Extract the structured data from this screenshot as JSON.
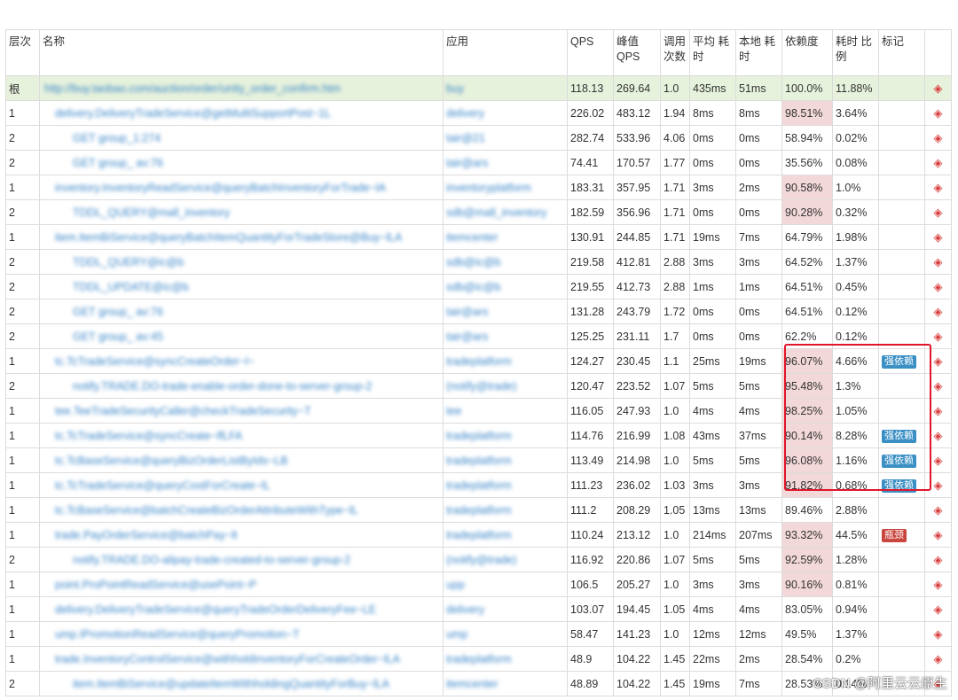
{
  "headers": {
    "level": "层次",
    "name": "名称",
    "app": "应用",
    "qps": "QPS",
    "peak_qps": "峰值 QPS",
    "call_count": "调用 次数",
    "avg_time": "平均 耗时",
    "local_time": "本地 耗时",
    "dependency": "依赖度",
    "time_ratio": "耗时 比例",
    "mark": "标记"
  },
  "rows": [
    {
      "level": "根",
      "name": "http://buy.taobao.com/auction/order/unity_order_confirm.htm",
      "app": "buy",
      "qps": "118.13",
      "peak": "269.64",
      "calls": "1.0",
      "avg": "435ms",
      "local": "51ms",
      "dep": "100.0%",
      "ratio": "11.88%",
      "mark": "",
      "markType": "",
      "hl": false
    },
    {
      "level": "1",
      "name": "delivery.DeliveryTradeService@getMultiSupportPost~1L",
      "app": "delivery",
      "qps": "226.02",
      "peak": "483.12",
      "calls": "1.94",
      "avg": "8ms",
      "local": "8ms",
      "dep": "98.51%",
      "ratio": "3.64%",
      "mark": "",
      "markType": "",
      "hl": true
    },
    {
      "level": "2",
      "name": "GET group_1:274",
      "app": "tair@21",
      "qps": "282.74",
      "peak": "533.96",
      "calls": "4.06",
      "avg": "0ms",
      "local": "0ms",
      "dep": "58.94%",
      "ratio": "0.02%",
      "mark": "",
      "markType": "",
      "hl": false
    },
    {
      "level": "2",
      "name": "GET group_ av:76",
      "app": "tair@ars",
      "qps": "74.41",
      "peak": "170.57",
      "calls": "1.77",
      "avg": "0ms",
      "local": "0ms",
      "dep": "35.56%",
      "ratio": "0.08%",
      "mark": "",
      "markType": "",
      "hl": false
    },
    {
      "level": "1",
      "name": "inventory.InventoryReadService@queryBatchInventoryForTrade~lA",
      "app": "inventoryplatform",
      "qps": "183.31",
      "peak": "357.95",
      "calls": "1.71",
      "avg": "3ms",
      "local": "2ms",
      "dep": "90.58%",
      "ratio": "1.0%",
      "mark": "",
      "markType": "",
      "hl": true
    },
    {
      "level": "2",
      "name": "TDDL_QUERY@mall_inventory",
      "app": "sdb@mall_inventory",
      "qps": "182.59",
      "peak": "356.96",
      "calls": "1.71",
      "avg": "0ms",
      "local": "0ms",
      "dep": "90.28%",
      "ratio": "0.32%",
      "mark": "",
      "markType": "",
      "hl": true
    },
    {
      "level": "1",
      "name": "item.ItemBiService@queryBatchItemQuantityForTradeStore@Buy~lLA",
      "app": "itemcenter",
      "qps": "130.91",
      "peak": "244.85",
      "calls": "1.71",
      "avg": "19ms",
      "local": "7ms",
      "dep": "64.79%",
      "ratio": "1.98%",
      "mark": "",
      "markType": "",
      "hl": false
    },
    {
      "level": "2",
      "name": "TDDL_QUERY@ic@b",
      "app": "sdb@ic@b",
      "qps": "219.58",
      "peak": "412.81",
      "calls": "2.88",
      "avg": "3ms",
      "local": "3ms",
      "dep": "64.52%",
      "ratio": "1.37%",
      "mark": "",
      "markType": "",
      "hl": false
    },
    {
      "level": "2",
      "name": "TDDL_UPDATE@ic@b",
      "app": "sdb@ic@b",
      "qps": "219.55",
      "peak": "412.73",
      "calls": "2.88",
      "avg": "1ms",
      "local": "1ms",
      "dep": "64.51%",
      "ratio": "0.45%",
      "mark": "",
      "markType": "",
      "hl": false
    },
    {
      "level": "2",
      "name": "GET group_ av:76",
      "app": "tair@ars",
      "qps": "131.28",
      "peak": "243.79",
      "calls": "1.72",
      "avg": "0ms",
      "local": "0ms",
      "dep": "64.51%",
      "ratio": "0.12%",
      "mark": "",
      "markType": "",
      "hl": false
    },
    {
      "level": "2",
      "name": "GET group_ av:45",
      "app": "tair@ars",
      "qps": "125.25",
      "peak": "231.11",
      "calls": "1.7",
      "avg": "0ms",
      "local": "0ms",
      "dep": "62.2%",
      "ratio": "0.12%",
      "mark": "",
      "markType": "",
      "hl": false
    },
    {
      "level": "1",
      "name": "tc.TcTradeService@syncCreateOrder~l~",
      "app": "tradeplatform",
      "qps": "124.27",
      "peak": "230.45",
      "calls": "1.1",
      "avg": "25ms",
      "local": "19ms",
      "dep": "96.07%",
      "ratio": "4.66%",
      "mark": "强依赖",
      "markType": "blue",
      "hl": true
    },
    {
      "level": "2",
      "name": "notify.TRADE.DO-trade-enable-order-done-to-server-group-2",
      "app": "(notify@trade)",
      "qps": "120.47",
      "peak": "223.52",
      "calls": "1.07",
      "avg": "5ms",
      "local": "5ms",
      "dep": "95.48%",
      "ratio": "1.3%",
      "mark": "",
      "markType": "",
      "hl": true
    },
    {
      "level": "1",
      "name": "tee.TeeTradeSecurityCaller@checkTradeSecurity~T",
      "app": "tee",
      "qps": "116.05",
      "peak": "247.93",
      "calls": "1.0",
      "avg": "4ms",
      "local": "4ms",
      "dep": "98.25%",
      "ratio": "1.05%",
      "mark": "",
      "markType": "",
      "hl": true
    },
    {
      "level": "1",
      "name": "tc.TcTradeService@syncCreate~lfLFA",
      "app": "tradeplatform",
      "qps": "114.76",
      "peak": "216.99",
      "calls": "1.08",
      "avg": "43ms",
      "local": "37ms",
      "dep": "90.14%",
      "ratio": "8.28%",
      "mark": "强依赖",
      "markType": "blue",
      "hl": true
    },
    {
      "level": "1",
      "name": "tc.TcBaseService@queryBizOrderListByIds~LB",
      "app": "tradeplatform",
      "qps": "113.49",
      "peak": "214.98",
      "calls": "1.0",
      "avg": "5ms",
      "local": "5ms",
      "dep": "96.08%",
      "ratio": "1.16%",
      "mark": "强依赖",
      "markType": "blue",
      "hl": true
    },
    {
      "level": "1",
      "name": "tc.TcTradeService@queryCostForCreate~lL",
      "app": "tradeplatform",
      "qps": "111.23",
      "peak": "236.02",
      "calls": "1.03",
      "avg": "3ms",
      "local": "3ms",
      "dep": "91.82%",
      "ratio": "0.68%",
      "mark": "强依赖",
      "markType": "blue",
      "hl": true
    },
    {
      "level": "1",
      "name": "tc.TcBaseService@batchCreateBizOrderAttributeWithType~lL",
      "app": "tradeplatform",
      "qps": "111.2",
      "peak": "208.29",
      "calls": "1.05",
      "avg": "13ms",
      "local": "13ms",
      "dep": "89.46%",
      "ratio": "2.88%",
      "mark": "",
      "markType": "",
      "hl": false
    },
    {
      "level": "1",
      "name": "trade.PayOrderService@batchPay~lt",
      "app": "tradeplatform",
      "qps": "110.24",
      "peak": "213.12",
      "calls": "1.0",
      "avg": "214ms",
      "local": "207ms",
      "dep": "93.32%",
      "ratio": "44.5%",
      "mark": "瓶颈",
      "markType": "red",
      "hl": true
    },
    {
      "level": "2",
      "name": "notify.TRADE.DO-alipay-trade-created-to-server-group-2",
      "app": "(notify@trade)",
      "qps": "116.92",
      "peak": "220.86",
      "calls": "1.07",
      "avg": "5ms",
      "local": "5ms",
      "dep": "92.59%",
      "ratio": "1.28%",
      "mark": "",
      "markType": "",
      "hl": true
    },
    {
      "level": "1",
      "name": "point.ProPointReadService@usePoint~P",
      "app": "upp",
      "qps": "106.5",
      "peak": "205.27",
      "calls": "1.0",
      "avg": "3ms",
      "local": "3ms",
      "dep": "90.16%",
      "ratio": "0.81%",
      "mark": "",
      "markType": "",
      "hl": true
    },
    {
      "level": "1",
      "name": "delivery.DeliveryTradeService@queryTradeOrderDeliveryFee~LE",
      "app": "delivery",
      "qps": "103.07",
      "peak": "194.45",
      "calls": "1.05",
      "avg": "4ms",
      "local": "4ms",
      "dep": "83.05%",
      "ratio": "0.94%",
      "mark": "",
      "markType": "",
      "hl": false
    },
    {
      "level": "1",
      "name": "ump.IPromotionReadService@queryPromotion~T",
      "app": "ump",
      "qps": "58.47",
      "peak": "141.23",
      "calls": "1.0",
      "avg": "12ms",
      "local": "12ms",
      "dep": "49.5%",
      "ratio": "1.37%",
      "mark": "",
      "markType": "",
      "hl": false
    },
    {
      "level": "1",
      "name": "trade.InventoryControlService@withholdInventoryForCreateOrder~lLA",
      "app": "tradeplatform",
      "qps": "48.9",
      "peak": "104.22",
      "calls": "1.45",
      "avg": "22ms",
      "local": "2ms",
      "dep": "28.54%",
      "ratio": "0.2%",
      "mark": "",
      "markType": "",
      "hl": false
    },
    {
      "level": "2",
      "name": "item.ItemBiService@updateItemWithholdingQuantityForBuy~lLA",
      "app": "itemcenter",
      "qps": "48.89",
      "peak": "104.22",
      "calls": "1.45",
      "avg": "19ms",
      "local": "7ms",
      "dep": "28.53%",
      "ratio": "0.14%",
      "mark": "",
      "markType": "",
      "hl": false
    }
  ],
  "action_icon": "diamond-expand-icon",
  "watermark": "CSDN @阿里云云原生",
  "colors": {
    "highlight": "#f2d8d8",
    "root": "#e7f2dd",
    "box": "#e0162b",
    "badge_blue": "#3a8fc4",
    "badge_red": "#c9453e"
  }
}
